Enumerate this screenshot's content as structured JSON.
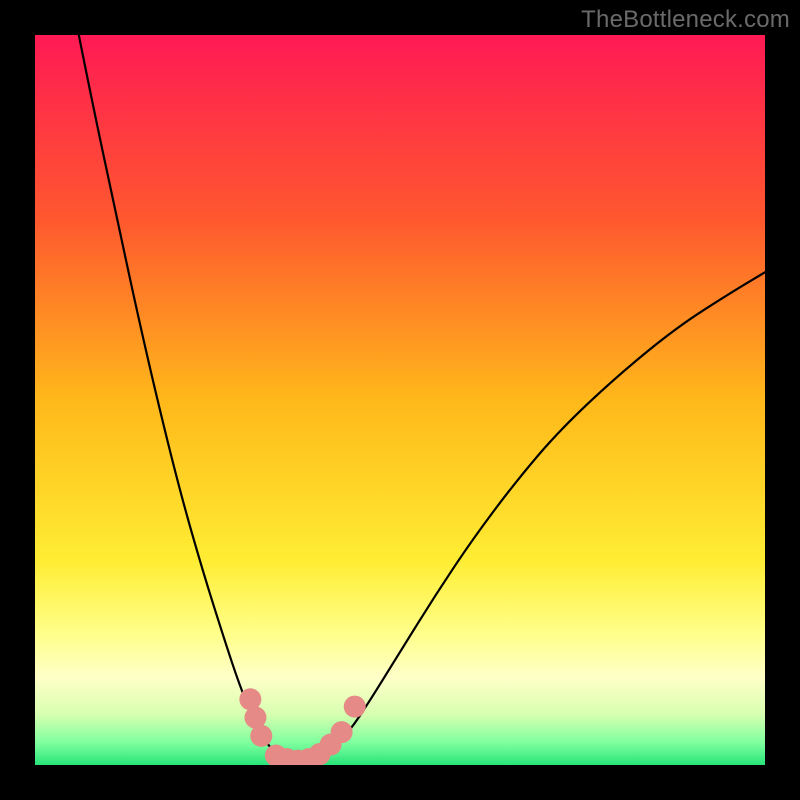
{
  "watermark": "TheBottleneck.com",
  "chart_data": {
    "type": "line",
    "title": "",
    "xlabel": "",
    "ylabel": "",
    "xlim": [
      0,
      100
    ],
    "ylim": [
      0,
      100
    ],
    "background_gradient": {
      "stops": [
        {
          "offset": 0.0,
          "color": "#ff1a54"
        },
        {
          "offset": 0.25,
          "color": "#ff572f"
        },
        {
          "offset": 0.5,
          "color": "#ffb81a"
        },
        {
          "offset": 0.72,
          "color": "#ffed33"
        },
        {
          "offset": 0.82,
          "color": "#ffff8a"
        },
        {
          "offset": 0.88,
          "color": "#ffffc8"
        },
        {
          "offset": 0.93,
          "color": "#d8ffb0"
        },
        {
          "offset": 0.97,
          "color": "#7dff9e"
        },
        {
          "offset": 1.0,
          "color": "#28e47a"
        }
      ]
    },
    "series": [
      {
        "name": "left-curve",
        "color": "#000000",
        "width": 2.2,
        "points": [
          {
            "x": 6.0,
            "y": 100.0
          },
          {
            "x": 8.0,
            "y": 90.0
          },
          {
            "x": 11.0,
            "y": 76.0
          },
          {
            "x": 14.0,
            "y": 62.0
          },
          {
            "x": 17.0,
            "y": 49.0
          },
          {
            "x": 20.0,
            "y": 37.0
          },
          {
            "x": 23.0,
            "y": 26.5
          },
          {
            "x": 26.0,
            "y": 17.0
          },
          {
            "x": 28.0,
            "y": 11.0
          },
          {
            "x": 30.0,
            "y": 6.0
          },
          {
            "x": 32.0,
            "y": 2.5
          },
          {
            "x": 34.0,
            "y": 0.8
          },
          {
            "x": 36.0,
            "y": 0.4
          }
        ]
      },
      {
        "name": "right-curve",
        "color": "#000000",
        "width": 2.2,
        "points": [
          {
            "x": 36.0,
            "y": 0.4
          },
          {
            "x": 38.0,
            "y": 0.5
          },
          {
            "x": 40.0,
            "y": 1.5
          },
          {
            "x": 43.0,
            "y": 4.5
          },
          {
            "x": 46.0,
            "y": 9.0
          },
          {
            "x": 50.0,
            "y": 15.5
          },
          {
            "x": 55.0,
            "y": 23.5
          },
          {
            "x": 60.0,
            "y": 31.0
          },
          {
            "x": 66.0,
            "y": 39.0
          },
          {
            "x": 72.0,
            "y": 46.0
          },
          {
            "x": 80.0,
            "y": 53.5
          },
          {
            "x": 88.0,
            "y": 60.0
          },
          {
            "x": 95.0,
            "y": 64.5
          },
          {
            "x": 100.0,
            "y": 67.5
          }
        ]
      }
    ],
    "markers": [
      {
        "name": "bottom-dots",
        "color": "#e58a86",
        "radius_px": 11,
        "points": [
          {
            "x": 29.5,
            "y": 9.0
          },
          {
            "x": 30.2,
            "y": 6.5
          },
          {
            "x": 31.0,
            "y": 4.0
          },
          {
            "x": 33.0,
            "y": 1.3
          },
          {
            "x": 34.5,
            "y": 0.8
          },
          {
            "x": 36.0,
            "y": 0.6
          },
          {
            "x": 37.5,
            "y": 0.8
          },
          {
            "x": 39.0,
            "y": 1.5
          },
          {
            "x": 40.5,
            "y": 2.8
          },
          {
            "x": 42.0,
            "y": 4.5
          },
          {
            "x": 43.8,
            "y": 8.0
          }
        ]
      }
    ]
  }
}
